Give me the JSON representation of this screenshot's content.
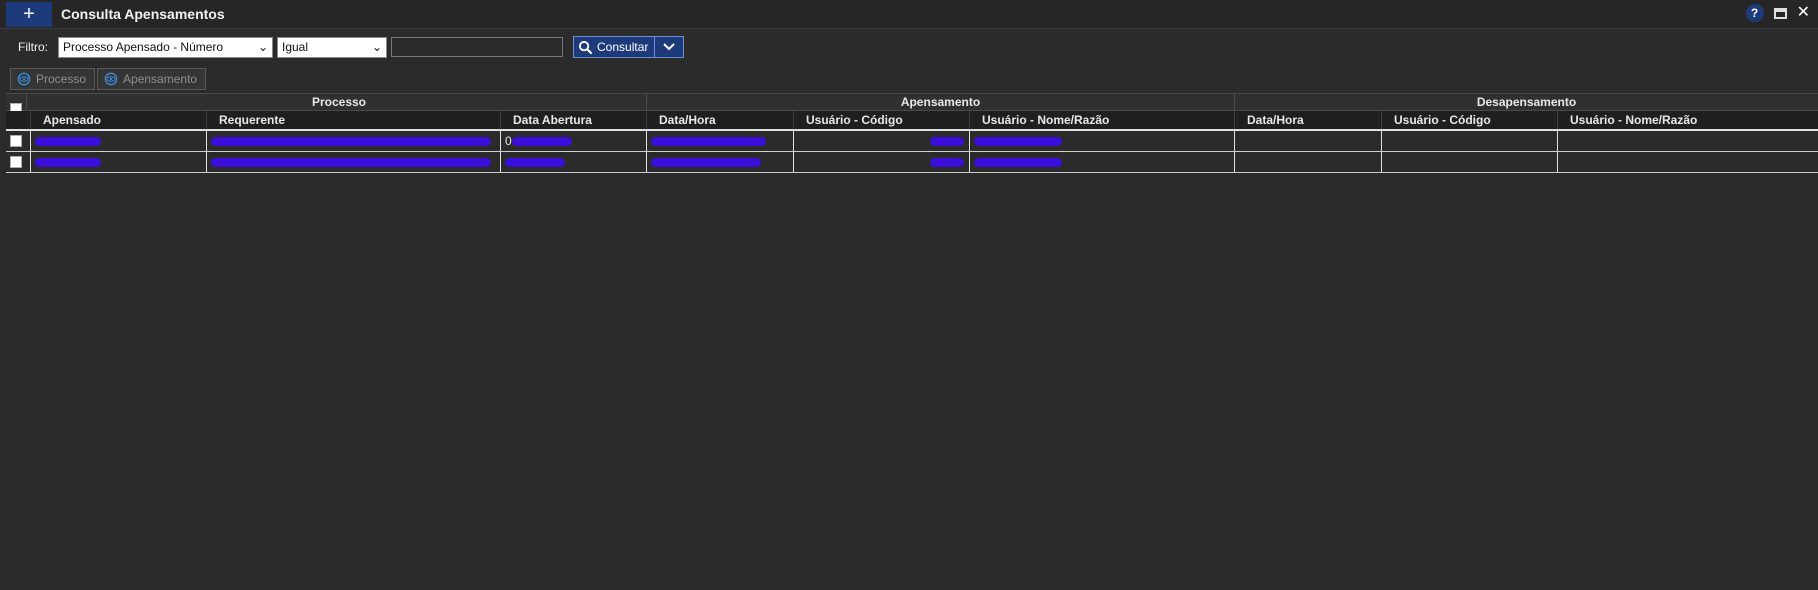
{
  "window": {
    "title": "Consulta Apensamentos",
    "add_label": "+",
    "help_label": "?",
    "close_label": "✕"
  },
  "filter": {
    "label": "Filtro:",
    "field_value": "Processo Apensado - Número",
    "operator_value": "Igual",
    "search_value": "",
    "search_button": "Consultar"
  },
  "tabs": {
    "processo": "Processo",
    "apensamento": "Apensamento"
  },
  "groups": {
    "processo": "Processo",
    "apensamento": "Apensamento",
    "desapensamento": "Desapensamento"
  },
  "columns": {
    "apensado": "Apensado",
    "requerente": "Requerente",
    "data_abertura": "Data Abertura",
    "ap_data_hora": "Data/Hora",
    "ap_usuario_codigo": "Usuário - Código",
    "ap_usuario_nome": "Usuário - Nome/Razão",
    "de_data_hora": "Data/Hora",
    "de_usuario_codigo": "Usuário - Código",
    "de_usuario_nome": "Usuário - Nome/Razão"
  },
  "rows": [
    {
      "data_abertura_prefix": "0"
    },
    {
      "data_abertura_prefix": ""
    }
  ],
  "colors": {
    "accent": "#1d3a7a",
    "redaction": "#3a0dd9"
  }
}
